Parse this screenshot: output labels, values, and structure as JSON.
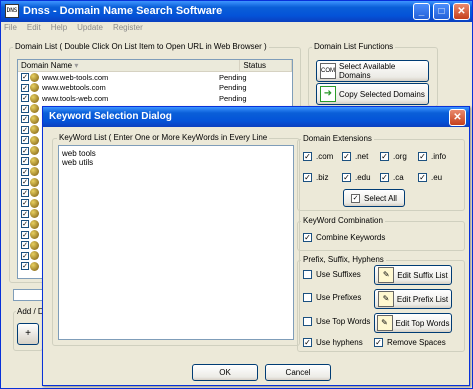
{
  "main": {
    "title": "Dnss - Domain Name Search Software",
    "app_icon": "DNS",
    "title_buttons": [
      "_",
      "□",
      "✕"
    ],
    "menu": [
      "File",
      "Edit",
      "Help",
      "Update",
      "Register"
    ],
    "domain_list_label": "Domain List ( Double Click On List Item to Open URL in Web Browser )",
    "columns": [
      "Domain Name",
      "Status"
    ],
    "rows": [
      {
        "domain": "www.web-tools.com",
        "status": "Pending"
      },
      {
        "domain": "www.webtools.com",
        "status": "Pending"
      },
      {
        "domain": "www.tools-web.com",
        "status": "Pending"
      },
      {
        "domain": "",
        "status": ""
      },
      {
        "domain": "",
        "status": ""
      },
      {
        "domain": "",
        "status": ""
      },
      {
        "domain": "",
        "status": ""
      },
      {
        "domain": "",
        "status": ""
      },
      {
        "domain": "",
        "status": ""
      },
      {
        "domain": "",
        "status": ""
      },
      {
        "domain": "",
        "status": ""
      },
      {
        "domain": "",
        "status": ""
      },
      {
        "domain": "",
        "status": ""
      },
      {
        "domain": "",
        "status": ""
      },
      {
        "domain": "",
        "status": ""
      },
      {
        "domain": "",
        "status": ""
      },
      {
        "domain": "",
        "status": ""
      },
      {
        "domain": "",
        "status": ""
      },
      {
        "domain": "",
        "status": ""
      }
    ],
    "functions_label": "Domain List Functions",
    "functions": [
      {
        "label": "Select Available Domains",
        "icon": "com-icon",
        "glyph": "COM"
      },
      {
        "label": "Copy Selected Domains",
        "icon": "green-arrow-icon",
        "glyph": "➜"
      }
    ],
    "add_label": "Add / D",
    "add_icon": "+"
  },
  "dialog": {
    "title": "Keyword Selection Dialog",
    "close_glyph": "✕",
    "keyword_label": "KeyWord List ( Enter One or More KeyWords in Every Line",
    "keywords": "web tools\nweb utils",
    "extensions_label": "Domain Extensions",
    "extensions": [
      ".com",
      ".net",
      ".org",
      ".info",
      ".biz",
      ".edu",
      ".ca",
      ".eu"
    ],
    "select_all": "Select All",
    "combination_label": "KeyWord Combination",
    "combine": "Combine Keywords",
    "psh_label": "Prefix, Suffix, Hyphens",
    "use_suffixes": "Use Suffixes",
    "use_prefixes": "Use Prefixes",
    "use_top_words": "Use Top Words",
    "use_hyphens": "Use hyphens",
    "remove_spaces": "Remove Spaces",
    "edit_suffix": "Edit Suffix List",
    "edit_prefix": "Edit Prefix List",
    "edit_top": "Edit Top Words",
    "ok": "OK",
    "cancel": "Cancel",
    "check_glyph": "✓"
  }
}
